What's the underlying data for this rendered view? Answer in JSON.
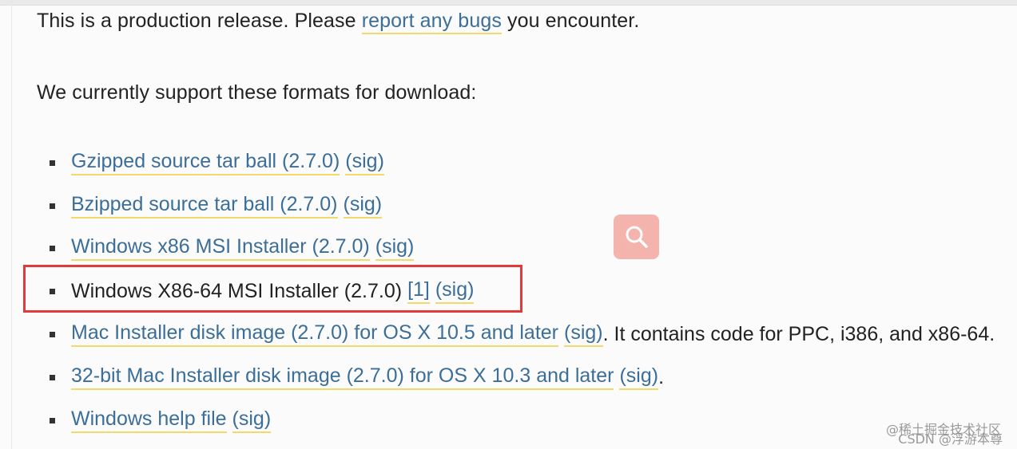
{
  "release_note": {
    "prefix": "This is a production release. Please",
    "link": "report any bugs",
    "suffix": "you encounter."
  },
  "formats_heading": "We currently support these formats for download:",
  "downloads": [
    {
      "label": "Gzipped source tar ball (2.7.0)",
      "sig": "(sig)"
    },
    {
      "label": "Bzipped source tar ball (2.7.0)",
      "sig": "(sig)"
    },
    {
      "label": "Windows x86 MSI Installer (2.7.0)",
      "sig": "(sig)"
    },
    {
      "label": "Windows X86-64 MSI Installer (2.7.0)",
      "footnote": "[1]",
      "sig": "(sig)"
    },
    {
      "label": "Mac Installer disk image (2.7.0) for OS X 10.5 and later",
      "sig": "(sig)",
      "tail": ". It contains code for PPC, i386, and x86-64."
    },
    {
      "label": "32-bit Mac Installer disk image (2.7.0) for OS X 10.3 and later",
      "sig": "(sig)",
      "tail": "."
    },
    {
      "label": "Windows help file",
      "sig": "(sig)"
    }
  ],
  "watermark": {
    "line1": "@稀土掘金技术社区",
    "line2": "CSDN @浮游本尊"
  },
  "colors": {
    "link": "#3b6e98",
    "link_underline": "#f3d96b",
    "highlight_border": "#e03a3a",
    "search_button": "#f5b3ad"
  },
  "icons": {
    "search_button": "search-icon"
  }
}
